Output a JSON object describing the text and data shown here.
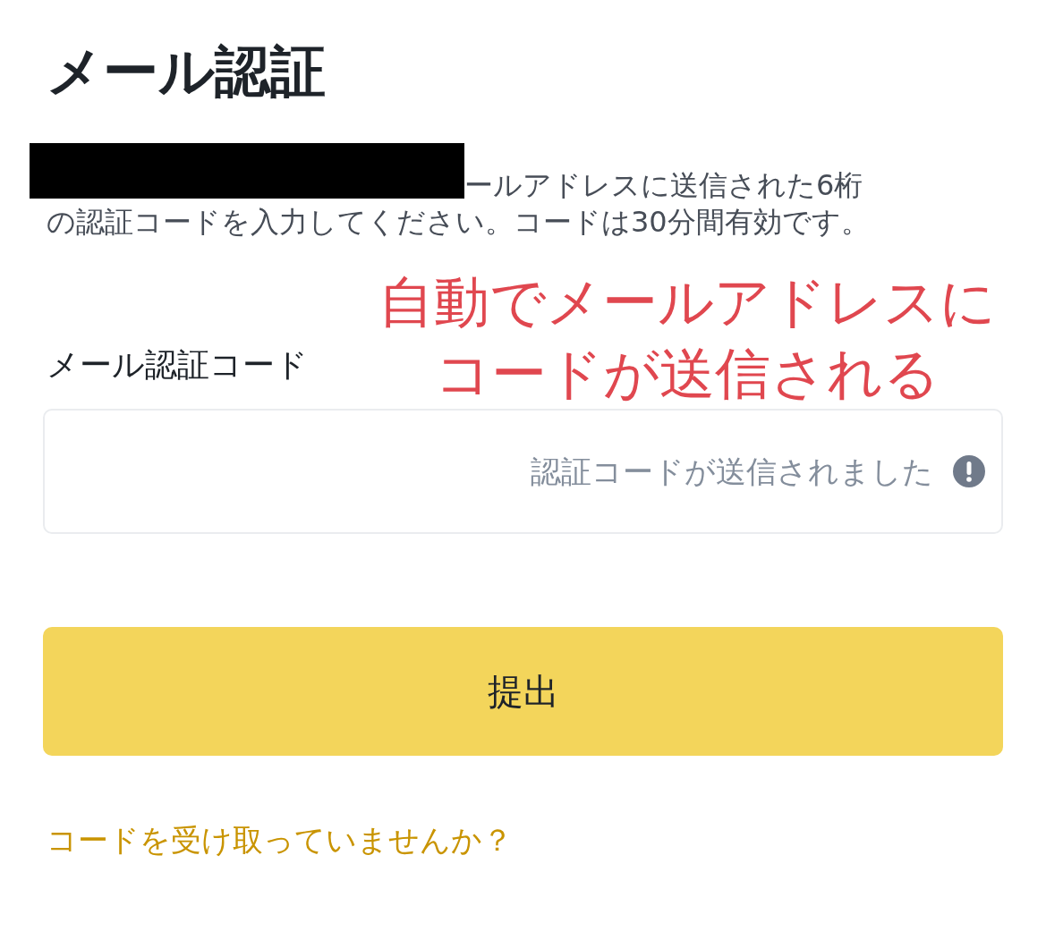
{
  "title": "メール認証",
  "description": [
    "ールアドレスに送信された6桁",
    "の認証コードを入力してください。コードは30分間有効です。"
  ],
  "annotation": [
    "自動でメールアドレスに",
    "コードが送信される"
  ],
  "code_field": {
    "label": "メール認証コード",
    "placeholder": "認証コードが送信されました"
  },
  "submit_button": "提出",
  "resend_link": "コードを受け取っていませんか？"
}
